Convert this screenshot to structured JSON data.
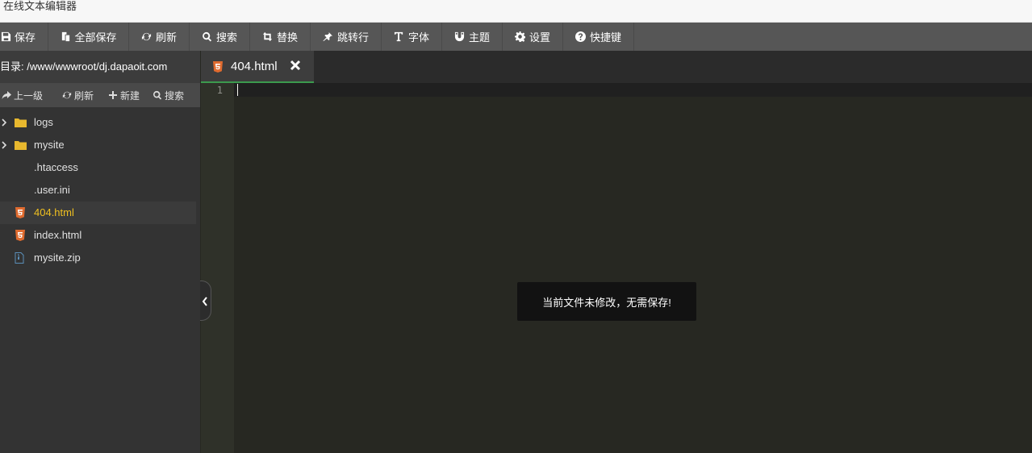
{
  "window": {
    "title": "在线文本编辑器"
  },
  "toolbar": {
    "buttons": [
      {
        "label": "保存",
        "icon": "save-icon"
      },
      {
        "label": "全部保存",
        "icon": "copy-icon"
      },
      {
        "label": "刷新",
        "icon": "refresh-icon"
      },
      {
        "label": "搜索",
        "icon": "search-icon"
      },
      {
        "label": "替换",
        "icon": "retweet-icon"
      },
      {
        "label": "跳转行",
        "icon": "pin-icon"
      },
      {
        "label": "字体",
        "icon": "text-height-icon"
      },
      {
        "label": "主题",
        "icon": "magnet-icon"
      },
      {
        "label": "设置",
        "icon": "gear-icon"
      },
      {
        "label": "快捷键",
        "icon": "question-icon"
      }
    ]
  },
  "sidebar": {
    "dir_label": "目录: /www/wwwroot/dj.dapaoit.com",
    "tools": [
      {
        "label": "上一级",
        "icon": "share-icon"
      },
      {
        "label": "刷新",
        "icon": "refresh-icon"
      },
      {
        "label": "新建",
        "icon": "plus-icon"
      },
      {
        "label": "搜索",
        "icon": "search-icon"
      }
    ],
    "files": [
      {
        "name": "logs",
        "type": "folder"
      },
      {
        "name": "mysite",
        "type": "folder"
      },
      {
        "name": ".htaccess",
        "type": "file"
      },
      {
        "name": ".user.ini",
        "type": "file"
      },
      {
        "name": "404.html",
        "type": "html",
        "active": true
      },
      {
        "name": "index.html",
        "type": "html"
      },
      {
        "name": "mysite.zip",
        "type": "zip"
      }
    ]
  },
  "tabs": [
    {
      "label": "404.html",
      "icon": "html5-icon"
    }
  ],
  "editor": {
    "line_number": "1"
  },
  "toast": {
    "message": "当前文件未修改，无需保存!"
  },
  "colors": {
    "active_file": "#f0c020",
    "tab_underline": "#3c9a4e",
    "html_icon": "#e06b2f",
    "folder": "#e8b82e"
  }
}
